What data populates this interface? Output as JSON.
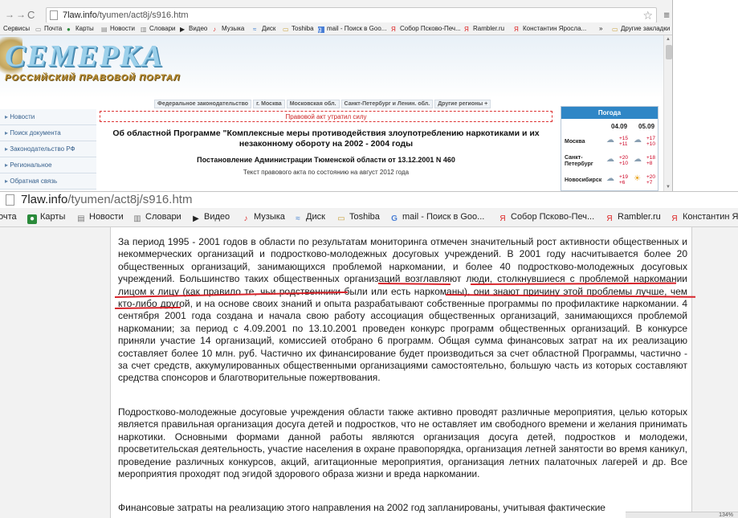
{
  "top_browser": {
    "url_host": "7law.info",
    "url_path": "/tyumen/act8j/s916.htm",
    "bookmarks": [
      "Сервисы",
      "Почта",
      "Карты",
      "Новости",
      "Словари",
      "Видео",
      "Музыка",
      "Диск",
      "Toshiba",
      "mail - Поиск в Goo...",
      "Собор Псково-Печ...",
      "Rambler.ru",
      "Константин Яросла..."
    ],
    "more_label": "»",
    "other_bookmarks": "Другие закладки"
  },
  "site": {
    "logo": "СЕМЕРКА",
    "logo_sub": "РОССИЙСКИЙ ПРАВОВОЙ ПОРТАЛ",
    "left_nav": [
      "Новости",
      "Поиск документа",
      "Законодательство РФ",
      "Региональное",
      "Обратная связь"
    ],
    "tabs": [
      "Федеральное законодательство",
      "г. Москва",
      "Московская обл.",
      "Санкт-Петербург и Ленин. обл.",
      "Другие регионы +"
    ],
    "act_banner": "Правовой акт утратил силу",
    "act_title": "Об областной Программе \"Комплексные меры противодействия злоупотреблению наркотиками и их незаконному обороту на 2002 - 2004 годы",
    "act_subtitle": "Постановление Администрации Тюменской области от 13.12.2001 N 460",
    "act_state": "Текст правового акта по состоянию на август 2012 года",
    "weather": {
      "title": "Погода",
      "dates": [
        "04.09",
        "05.09"
      ],
      "cities": [
        {
          "name": "Москва",
          "d1": [
            "+15",
            "+11"
          ],
          "d2": [
            "+17",
            "+10"
          ]
        },
        {
          "name": "Санкт-Петербург",
          "d1": [
            "+20",
            "+10"
          ],
          "d2": [
            "+18",
            "+8"
          ]
        },
        {
          "name": "Новосибирск",
          "d1": [
            "+19",
            "+6"
          ],
          "d2": [
            "+20",
            "+7"
          ]
        }
      ]
    }
  },
  "big_browser": {
    "url_host": "7law.info",
    "url_path": "/tyumen/act8j/s916.htm",
    "bookmarks": [
      "очта",
      "Карты",
      "Новости",
      "Словари",
      "Видео",
      "Музыка",
      "Диск",
      "Toshiba",
      "mail - Поиск в Goo...",
      "Собор Псково-Печ...",
      "Rambler.ru",
      "Константин Я"
    ]
  },
  "article": {
    "p1_a": "За период 1995 - 2001 годов в области по результатам мониторинга отмечен значительный рост активности общественных и некоммерческих организаций и подростково-молодежных досуговых учреждений. В 2001 году насчитывается более 20 общественных организаций, занимающихся проблемой наркомании, и более 40 подростково-молодежных досуговых учреждений. ",
    "p1_b": "Большинство таких общественных организаций возглавляют люди, столкнувшиеся с проблемой наркомании лицом к лицу (как правило те, чьи родственники были или есть наркоманы)",
    "p1_c": ", они знают причину этой проблемы лучше, чем кто-либо другой, и на основе своих знаний и опыта разрабатывают собственные программы по профилактике наркомании. 4 сентября 2001 года создана и начала свою работу ассоциация общественных организаций, занимающихся проблемой наркомании; за период с 4.09.2001 по 13.10.2001 проведен конкурс программ общественных организаций. В конкурсе приняли участие 14 организаций, комиссией отобрано 6 программ. Общая сумма финансовых затрат на их реализацию составляет более 10 млн. руб. Частично их финансирование будет производиться за счет областной Программы, частично - за счет средств, аккумулированных общественными организациями самостоятельно, большую часть из которых составляют средства спонсоров и благотворительные пожертвования.",
    "p2": "Подростково-молодежные досуговые учреждения области также активно проводят различные мероприятия, целью которых является правильная организация досуга детей и подростков, что не оставляет им свободного времени и желания принимать наркотики. Основными формами данной работы являются организация досуга детей, подростков и молодежи, просветительская деятельность, участие населения в охране правопорядка, организация летней занятости во время каникул, проведение различных конкурсов, акций, агитационные мероприятия, организация летних палаточных лагерей и др. Все мероприятия проходят под эгидой здорового образа жизни и вреда наркомании.",
    "p3": "Финансовые затраты на реализацию этого направления на 2002 год запланированы, учитывая фактические"
  },
  "status": {
    "zoom": "134%"
  }
}
